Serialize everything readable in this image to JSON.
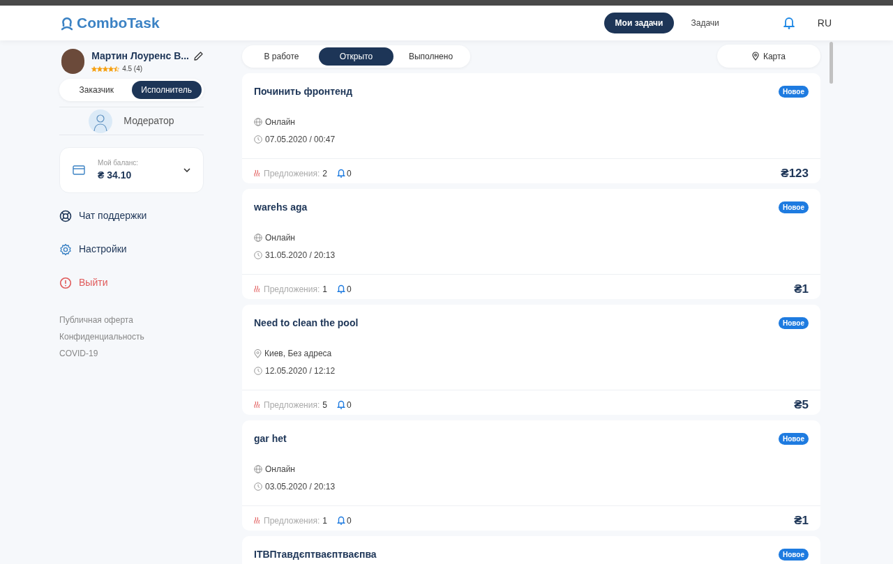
{
  "header": {
    "logo": "ComboTask",
    "nav": [
      {
        "label": "Мои задачи",
        "selected": true
      },
      {
        "label": "Задачи",
        "selected": false
      }
    ],
    "language": "RU"
  },
  "profile": {
    "name": "Мартин Лоуренс В...",
    "stars": 4.5,
    "rating": "4.5 (4)",
    "roles": [
      {
        "label": "Заказчик",
        "selected": false
      },
      {
        "label": "Исполнитель",
        "selected": true
      }
    ],
    "moderator": "Модератор"
  },
  "balance": {
    "label": "Мой баланс:",
    "amount": "₴ 34.10"
  },
  "menu": [
    {
      "kind": "support",
      "label": "Чат поддержки"
    },
    {
      "kind": "settings",
      "label": "Настройки"
    },
    {
      "kind": "logout",
      "label": "Выйти"
    }
  ],
  "footer_links": [
    "Публичная оферта",
    "Конфиденциальность",
    "COVID-19"
  ],
  "status_tabs": [
    {
      "label": "В работе",
      "selected": false
    },
    {
      "label": "Открыто",
      "selected": true
    },
    {
      "label": "Выполнено",
      "selected": false
    }
  ],
  "map_button": "Карта",
  "tasks": [
    {
      "title": "Починить фронтенд",
      "badge": "Новое",
      "kind": "online",
      "location": "Онлайн",
      "date": "07.05.2020 / 00:47",
      "offers_label": "Предложения:",
      "offers": "2",
      "notifications": "0",
      "price": "₴123"
    },
    {
      "title": "warehs aga",
      "badge": "Новое",
      "kind": "online",
      "location": "Онлайн",
      "date": "31.05.2020 / 20:13",
      "offers_label": "Предложения:",
      "offers": "1",
      "notifications": "0",
      "price": "₴1"
    },
    {
      "title": "Need to clean the pool",
      "badge": "Новое",
      "kind": "address",
      "location": "Киев, Без адреса",
      "date": "12.05.2020 / 12:12",
      "offers_label": "Предложения:",
      "offers": "5",
      "notifications": "0",
      "price": "₴5"
    },
    {
      "title": "gar het",
      "badge": "Новое",
      "kind": "online",
      "location": "Онлайн",
      "date": "03.05.2020 / 20:13",
      "offers_label": "Предложения:",
      "offers": "1",
      "notifications": "0",
      "price": "₴1"
    },
    {
      "title": "ІТВПтавдєптваєптваєпва",
      "badge": "Новое"
    }
  ]
}
